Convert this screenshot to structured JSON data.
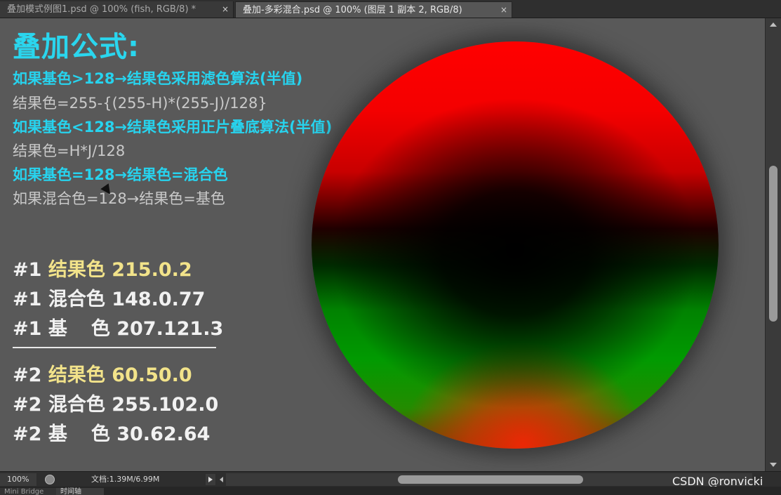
{
  "tabs": [
    {
      "label": "叠加模式例图1.psd @ 100% (fish, RGB/8) *",
      "close": "×"
    },
    {
      "label": "叠加-多彩混合.psd @ 100% (图层 1 副本 2, RGB/8)",
      "close": "×"
    }
  ],
  "content": {
    "title": "叠加公式:",
    "lines": [
      "如果基色>128→结果色采用滤色算法(半值)",
      "结果色=255-{(255-H)*(255-J)/128}",
      "如果基色<128→结果色采用正片叠底算法(半值)",
      "结果色=H*J/128",
      "如果基色=128→结果色=混合色",
      "如果混合色=128→结果色=基色"
    ],
    "examples": [
      {
        "prefix": "#1",
        "label": "结果色",
        "value": "215.0.2"
      },
      {
        "prefix": "#1",
        "label": "混合色",
        "value": "148.0.77"
      },
      {
        "prefix": "#1",
        "label_a": "基",
        "label_b": "色",
        "value": "207.121.3"
      },
      {
        "prefix": "#2",
        "label": "结果色",
        "value": "60.50.0"
      },
      {
        "prefix": "#2",
        "label": "混合色",
        "value": "255.102.0"
      },
      {
        "prefix": "#2",
        "label_a": "基",
        "label_b": "色",
        "value": "30.62.64"
      }
    ]
  },
  "status": {
    "zoom": "100%",
    "doc": "文档:1.39M/6.99M",
    "watermark": "CSDN @ronvicki"
  },
  "bottom_tabs": [
    "Mini Bridge",
    "时间轴"
  ],
  "colors": {
    "accent_cyan": "#27d3ee",
    "highlight_yellow": "#f2e38a",
    "canvas_grey": "#595959"
  }
}
